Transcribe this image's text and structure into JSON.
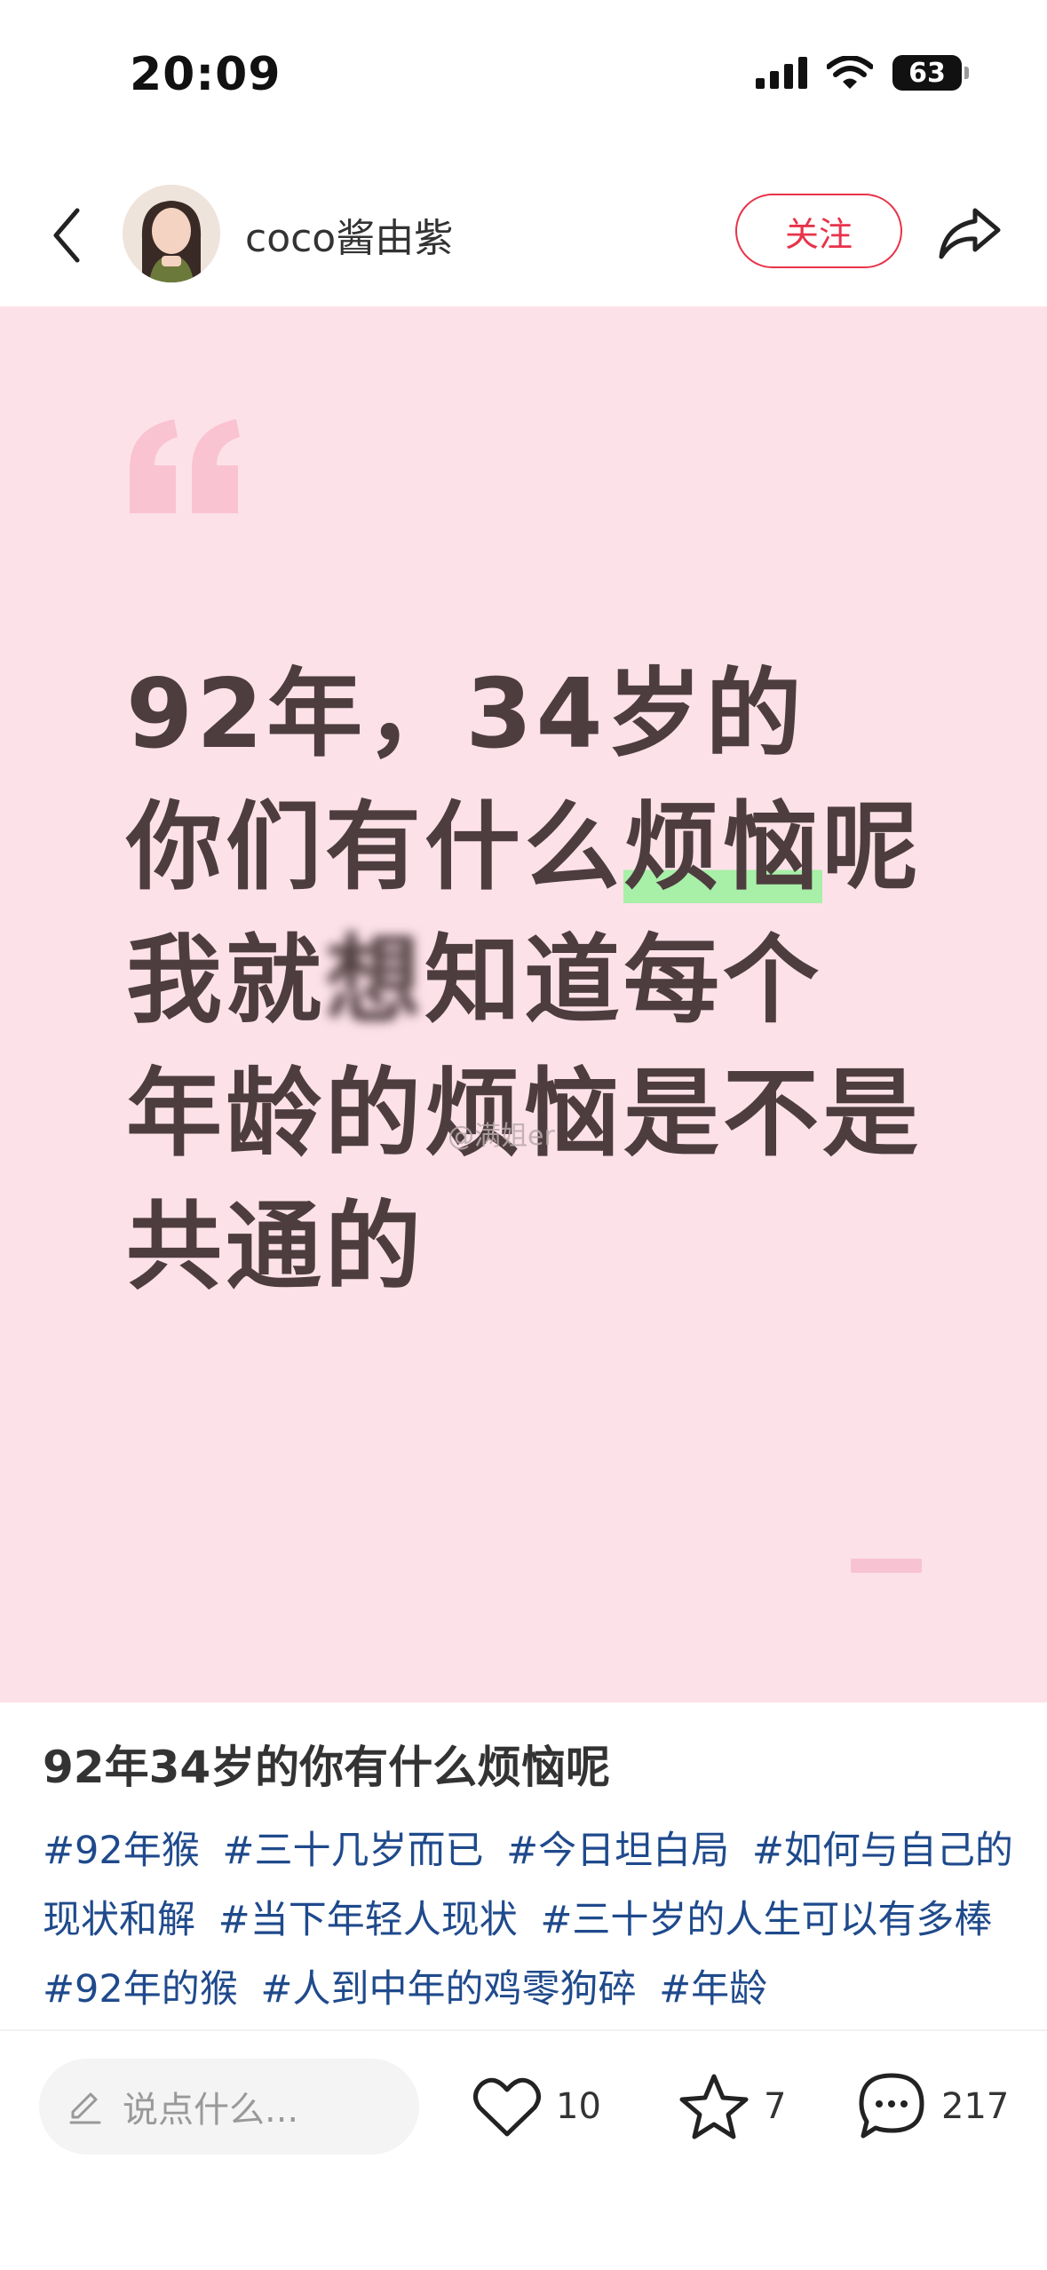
{
  "status_bar": {
    "time": "20:09",
    "battery": "63"
  },
  "header": {
    "author": "coco酱由紫",
    "follow_label": "关注"
  },
  "post_image": {
    "lines": [
      {
        "segments": [
          "92年，34岁的"
        ]
      },
      {
        "before": "你们有什么",
        "highlight": "烦恼",
        "after": "呢"
      },
      {
        "before": "我就",
        "smudge": "想",
        "after": "知道每个"
      },
      {
        "segments": [
          "年龄的烦恼是不是"
        ]
      },
      {
        "segments": [
          "共通的"
        ]
      }
    ],
    "watermark": "@满姐er"
  },
  "caption": {
    "title": "92年34岁的你有什么烦恼呢",
    "tags": [
      "#92年猴",
      "#三十几岁而已",
      "#今日坦白局",
      "#如何与自己的现状和解",
      "#当下年轻人现状",
      "#三十岁的人生可以有多棒",
      "#92年的猴",
      "#人到中年的鸡零狗碎",
      "#年龄"
    ]
  },
  "bottom_bar": {
    "comment_placeholder": "说点什么...",
    "likes": "10",
    "collects": "7",
    "comments": "217"
  },
  "colors": {
    "accent": "#e8334a",
    "image_background": "#fde1e9",
    "quote_text": "#4d3d3f",
    "highlight": "#a8efa8",
    "tag_link": "#1f4a8c"
  },
  "icons": {
    "back": "chevron-left-icon",
    "share": "share-arrow-icon",
    "like": "heart-icon",
    "collect": "star-icon",
    "comment": "speech-bubble-icon",
    "edit": "pencil-icon"
  }
}
